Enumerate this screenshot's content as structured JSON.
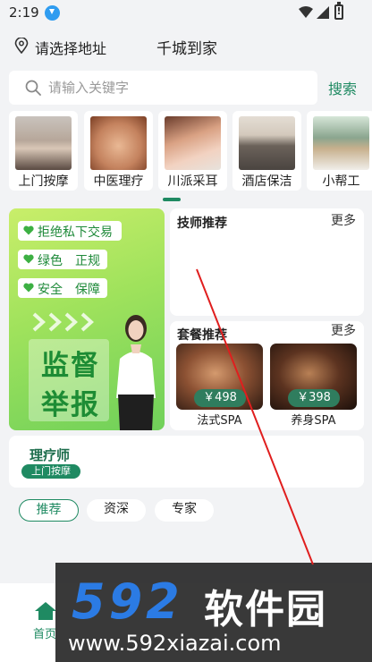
{
  "status_bar": {
    "time": "2:19"
  },
  "location": {
    "text": "请选择地址",
    "app_title": "千城到家"
  },
  "search": {
    "placeholder": "请输入关键字",
    "button_label": "搜索"
  },
  "categories": [
    {
      "label": "上门按摩"
    },
    {
      "label": "中医理疗"
    },
    {
      "label": "川派采耳"
    },
    {
      "label": "酒店保洁"
    },
    {
      "label": "小帮工"
    }
  ],
  "promo": {
    "points": [
      "拒绝私下交易",
      "绿色　正规",
      "安全　保障"
    ],
    "headline_1": "监督",
    "headline_2": "举报"
  },
  "technician": {
    "title": "技师推荐",
    "more": "更多"
  },
  "packages": {
    "title": "套餐推荐",
    "more": "更多",
    "items": [
      {
        "price": "￥498",
        "name": "法式SPA"
      },
      {
        "price": "￥398",
        "name": "养身SPA"
      }
    ]
  },
  "therapist": {
    "title": "理疗师",
    "badge": "上门按摩"
  },
  "filters": [
    "推荐",
    "资深",
    "专家"
  ],
  "bottom_nav": {
    "home_label": "首页"
  },
  "watermark": {
    "logo_number": "592",
    "logo_text": "软件园",
    "url": "www.592xiazai.com"
  },
  "colors": {
    "accent": "#1f8a62",
    "promo_green": "#9fe25c",
    "watermark_blue": "#2b7be4"
  }
}
